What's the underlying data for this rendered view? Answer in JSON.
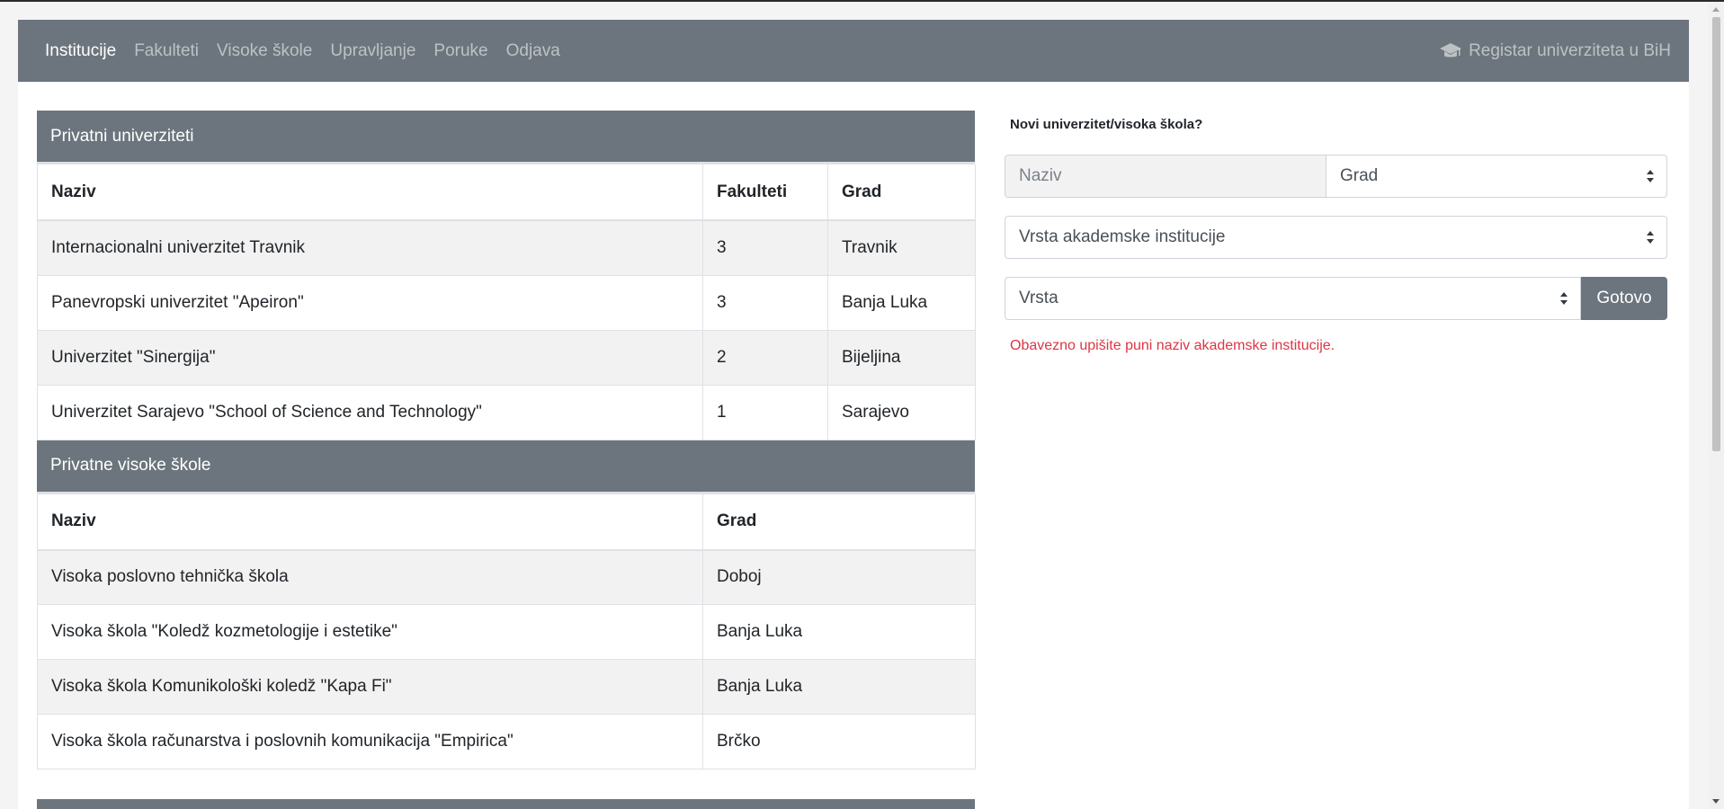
{
  "nav": {
    "links": [
      {
        "label": "Institucije",
        "active": true
      },
      {
        "label": "Fakulteti",
        "active": false
      },
      {
        "label": "Visoke škole",
        "active": false
      },
      {
        "label": "Upravljanje",
        "active": false
      },
      {
        "label": "Poruke",
        "active": false
      },
      {
        "label": "Odjava",
        "active": false
      }
    ],
    "brand": "Registar univerziteta u BiH",
    "brand_icon": "graduation-cap-icon"
  },
  "private_universities": {
    "title": "Privatni univerziteti",
    "columns": [
      "Naziv",
      "Fakulteti",
      "Grad"
    ],
    "rows": [
      [
        "Internacionalni univerzitet Travnik",
        "3",
        "Travnik"
      ],
      [
        "Panevropski univerzitet \"Apeiron\"",
        "3",
        "Banja Luka"
      ],
      [
        "Univerzitet \"Sinergija\"",
        "2",
        "Bijeljina"
      ],
      [
        "Univerzitet Sarajevo \"School of Science and Technology\"",
        "1",
        "Sarajevo"
      ]
    ]
  },
  "private_colleges": {
    "title": "Privatne visoke škole",
    "columns": [
      "Naziv",
      "Grad"
    ],
    "rows": [
      [
        "Visoka poslovno tehnička škola",
        "Doboj"
      ],
      [
        "Visoka škola \"Koledž kozmetologije i estetike\"",
        "Banja Luka"
      ],
      [
        "Visoka škola Komunikološki koledž \"Kapa Fi\"",
        "Banja Luka"
      ],
      [
        "Visoka škola računarstva i poslovnih komunikacija \"Empirica\"",
        "Brčko"
      ]
    ]
  },
  "form": {
    "title": "Novi univerzitet/visoka škola?",
    "name_placeholder": "Naziv",
    "city_select": "Grad",
    "type_select": "Vrsta akademske institucije",
    "kind_select": "Vrsta",
    "submit_label": "Gotovo",
    "error": "Obavezno upišite puni naziv akademske institucije."
  },
  "colors": {
    "navbar": "#6c757d",
    "error": "#dc3545"
  }
}
